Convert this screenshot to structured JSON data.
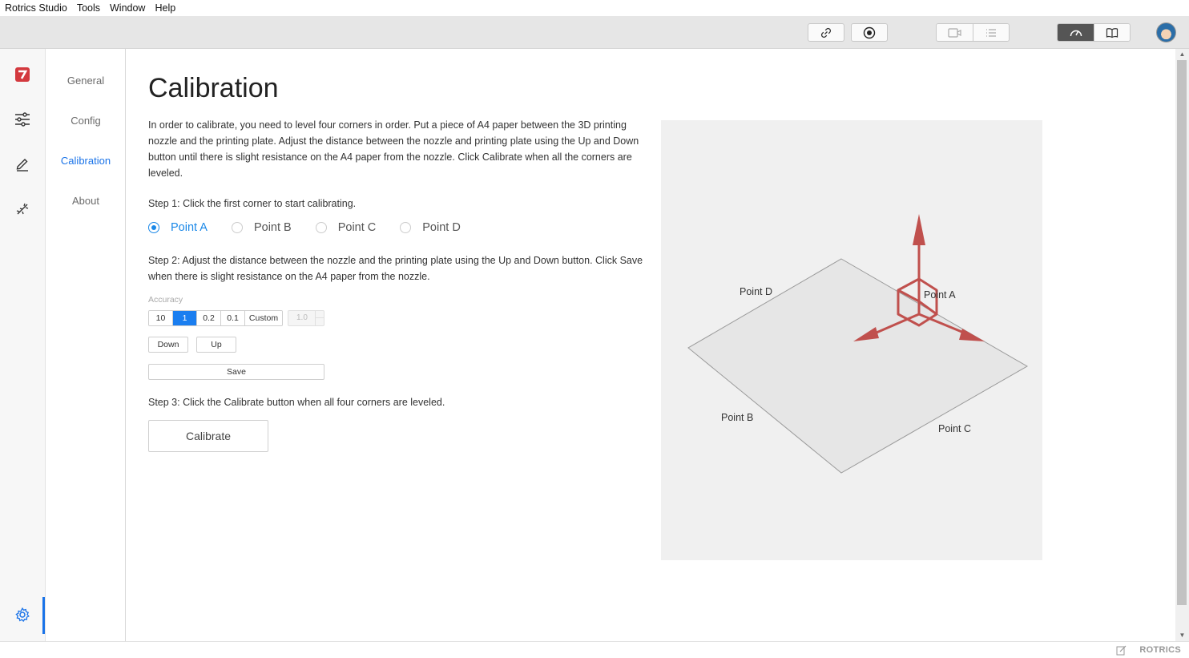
{
  "menu": [
    "Rotrics Studio",
    "Tools",
    "Window",
    "Help"
  ],
  "nav": {
    "items": [
      {
        "label": "General",
        "active": false
      },
      {
        "label": "Config",
        "active": false
      },
      {
        "label": "Calibration",
        "active": true
      },
      {
        "label": "About",
        "active": false
      }
    ]
  },
  "page": {
    "title": "Calibration",
    "intro": "In order to calibrate, you need to level four corners in order. Put a piece of A4 paper between the 3D printing nozzle and the printing plate. Adjust the distance between the nozzle and printing plate using the Up and Down button until there is slight resistance on the A4 paper from the nozzle. Click Calibrate when all the corners are leveled.",
    "step1": "Step 1: Click the first corner to start calibrating.",
    "points": [
      {
        "label": "Point A",
        "selected": true
      },
      {
        "label": "Point B",
        "selected": false
      },
      {
        "label": "Point C",
        "selected": false
      },
      {
        "label": "Point D",
        "selected": false
      }
    ],
    "step2": "Step 2: Adjust the distance between the nozzle and the printing plate using the Up and Down button. Click Save when there is slight resistance on the A4 paper from the nozzle.",
    "accuracy_label": "Accuracy",
    "accuracy_options": [
      "10",
      "1",
      "0.2",
      "0.1",
      "Custom"
    ],
    "accuracy_selected": "1",
    "custom_value": "1.0",
    "down_label": "Down",
    "up_label": "Up",
    "save_label": "Save",
    "step3": "Step 3: Click the Calibrate button when all four corners are leveled.",
    "calibrate_label": "Calibrate"
  },
  "illustration": {
    "labels": {
      "a": "Point A",
      "b": "Point B",
      "c": "Point C",
      "d": "Point D"
    },
    "axis_color": "#c0504d"
  },
  "status": {
    "brand": "ROTRICS"
  },
  "colors": {
    "accent": "#1a73e8",
    "radio": "#1a88e8",
    "selected_button": "#1a7ef0"
  }
}
